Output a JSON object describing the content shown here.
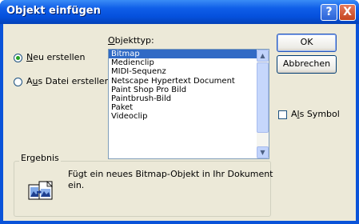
{
  "window": {
    "title": "Objekt einfügen",
    "help_button": "?",
    "close_button": "X"
  },
  "left": {
    "radio_new": {
      "prefix": "",
      "accel": "N",
      "rest": "eu erstellen",
      "checked": true
    },
    "radio_file": {
      "prefix": "A",
      "accel": "u",
      "rest": "s Datei erstellen",
      "checked": false
    }
  },
  "objecttype": {
    "label_accel": "O",
    "label_rest": "bjekttyp:",
    "items": [
      "Bitmap",
      "Medienclip",
      "MIDI-Sequenz",
      "Netscape Hypertext Document",
      "Paint Shop Pro Bild",
      "Paintbrush-Bild",
      "Paket",
      "Videoclip"
    ],
    "selected": "Bitmap"
  },
  "buttons": {
    "ok": "OK",
    "cancel": "Abbrechen"
  },
  "checkbox_symbol": {
    "prefix": "A",
    "accel": "l",
    "rest": "s Symbol",
    "checked": false
  },
  "result": {
    "title": "Ergebnis",
    "text_line1": "Fügt ein neues Bitmap-Objekt in Ihr Dokument",
    "text_line2": "ein."
  },
  "icons": {
    "help": "help-icon",
    "close": "close-icon",
    "result": "bitmap-object-icon"
  }
}
